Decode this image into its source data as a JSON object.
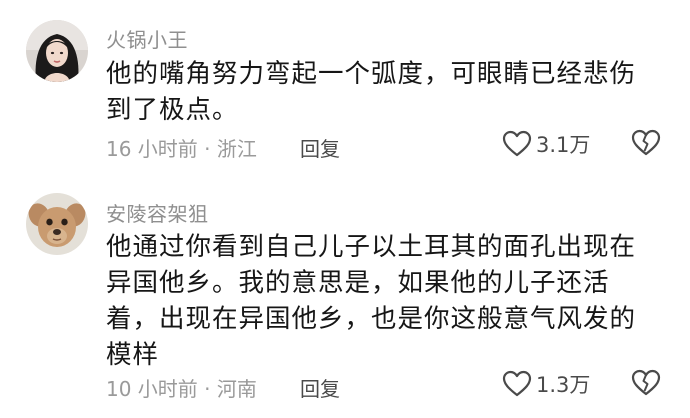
{
  "comments": [
    {
      "username": "火锅小王",
      "text_lines": [
        "他的嘴角努力弯起一个弧度，可眼睛已经悲伤",
        "到了极点。"
      ],
      "time": "16 小时前",
      "location": "浙江",
      "meta_separator": " · ",
      "reply_label": "回复",
      "like_count": "3.1万",
      "avatar_icon": "avatar-girl-photo",
      "like_icon": "heart-outline-icon",
      "dislike_icon": "broken-heart-icon"
    },
    {
      "username": "安陵容架狙",
      "text_lines": [
        "他通过你看到自己儿子以土耳其的面孔出现在",
        "异国他乡。我的意思是，如果他的儿子还活",
        "着，出现在异国他乡，也是你这般意气风发的",
        "模样"
      ],
      "time": "10 小时前",
      "location": "河南",
      "meta_separator": " · ",
      "reply_label": "回复",
      "like_count": "1.3万",
      "avatar_icon": "avatar-dog-photo",
      "like_icon": "heart-outline-icon",
      "dislike_icon": "broken-heart-icon"
    }
  ],
  "colors": {
    "username": "#8f8f8f",
    "text": "#161616",
    "meta": "#9a9a9a",
    "action": "#4a4a4a"
  }
}
